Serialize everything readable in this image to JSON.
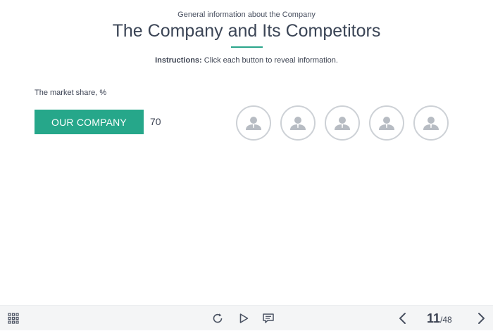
{
  "header": {
    "subtitle": "General information about the Company",
    "title": "The Company and Its Competitors",
    "accent_color": "#26a78a"
  },
  "instructions": {
    "label": "Instructions:",
    "text": " Click each button to reveal information."
  },
  "market": {
    "label": "The market share, %",
    "company_button_label": "OUR COMPANY",
    "company_value": "70",
    "competitor_count": 5,
    "competitor_icon": "user-avatar-icon"
  },
  "player_controls": {
    "menu_icon": "grid-menu-icon",
    "replay_icon": "replay-icon",
    "play_icon": "play-icon",
    "notes_icon": "notes-icon",
    "prev_icon": "chevron-left-icon",
    "next_icon": "chevron-right-icon",
    "current_page": "11",
    "total_pages": "/48"
  }
}
